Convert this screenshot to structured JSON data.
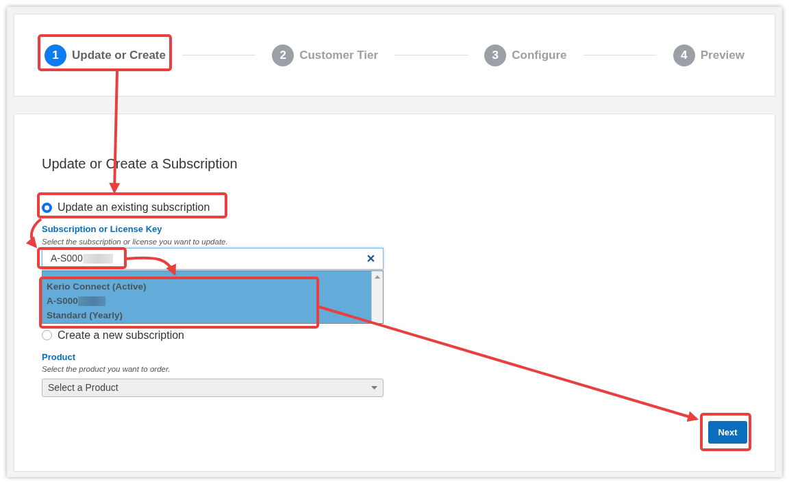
{
  "steps": [
    {
      "number": "1",
      "label": "Update or Create",
      "selected": true
    },
    {
      "number": "2",
      "label": "Customer Tier",
      "selected": false
    },
    {
      "number": "3",
      "label": "Configure",
      "selected": false
    },
    {
      "number": "4",
      "label": "Preview",
      "selected": false
    }
  ],
  "form": {
    "title": "Update or Create a Subscription",
    "options": [
      {
        "label": "Update an existing subscription",
        "selected": true
      },
      {
        "label": "Create a new subscription",
        "selected": false
      }
    ],
    "key_field": {
      "label": "Subscription or License Key",
      "hint": "Select the subscription or license you want to update.",
      "value": "A-S000",
      "dropdown": [
        {
          "lines": [
            "Kerio Connect (Active)",
            "A-S000",
            "Standard (Yearly)"
          ],
          "selected": true
        }
      ]
    },
    "product_field": {
      "label": "Product",
      "hint": "Select the product you want to order.",
      "placeholder": "Select a Product"
    }
  },
  "buttons": [
    "Next"
  ]
}
